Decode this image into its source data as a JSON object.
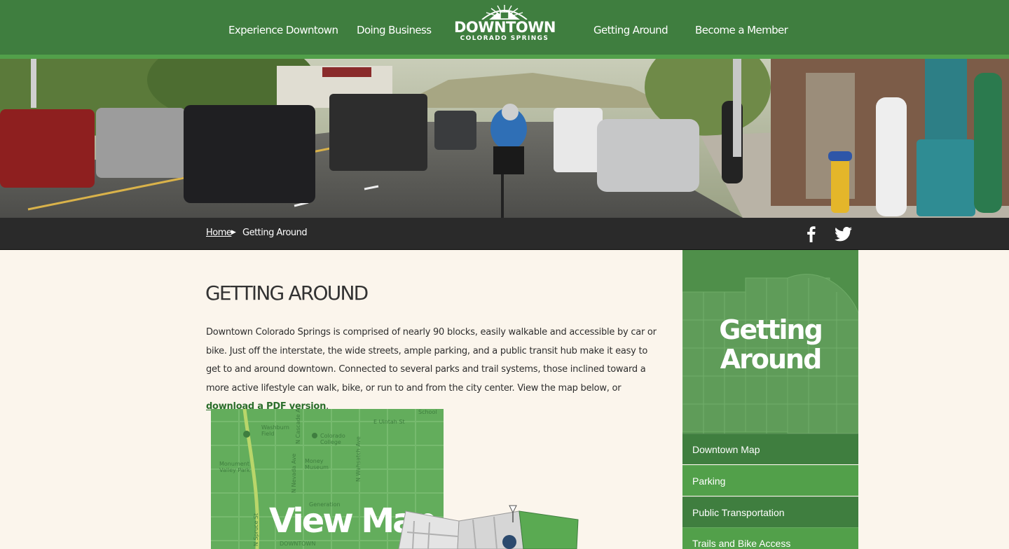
{
  "nav": {
    "left": [
      "Experience Downtown",
      "Doing Business"
    ],
    "right": [
      "Getting Around",
      "Become a Member"
    ]
  },
  "logo": {
    "main": "DOWNTOWN",
    "sub": "COLORADO SPRINGS"
  },
  "breadcrumb": {
    "home": "Home",
    "current": "Getting Around"
  },
  "social": {
    "facebook_icon": "facebook-icon",
    "twitter_icon": "twitter-icon"
  },
  "page": {
    "title": "Getting Around",
    "intro_text": "Downtown Colorado Springs is comprised of nearly 90 blocks, easily walkable and accessible by car or bike.  Just off the interstate, the wide streets, ample parking, and a public transit hub make it easy to get to and around downtown. Connected to several parks and trail systems, those inclined toward a more active lifestyle can walk, bike, or run to and from the city center. View the map below, or ",
    "intro_link": "download a PDF version",
    "intro_end": "."
  },
  "map_tile": {
    "cta": "View Map",
    "labels": [
      "E Uintah St",
      "School",
      "Washburn Field",
      "N Cascade Ave",
      "Colorado College",
      "N Nevada Ave",
      "N Wahsatch Ave",
      "Monument Valley Park",
      "Money Museum",
      "N Spruce St",
      "Generation",
      "DOWNTOWN"
    ]
  },
  "sidebar": {
    "title_line1": "Getting",
    "title_line2": "Around",
    "items": [
      "Downtown Map",
      "Parking",
      "Public Transportation",
      "Trails and Bike Access"
    ]
  },
  "colors": {
    "header_green": "#3f7e3f",
    "accent_green": "#52a04a",
    "page_bg": "#fbf5ec",
    "crumb_bar": "#2a2a2a"
  }
}
